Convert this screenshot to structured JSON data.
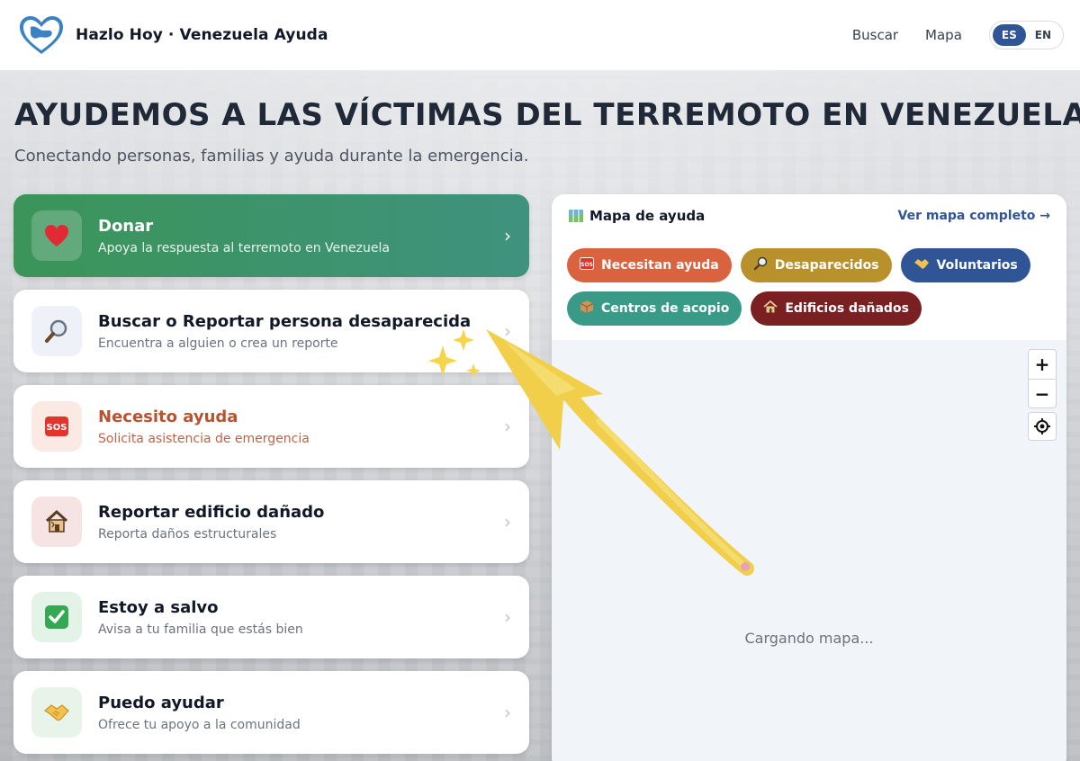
{
  "header": {
    "brand": "Hazlo Hoy · Venezuela Ayuda",
    "nav": {
      "search": "Buscar",
      "map": "Mapa"
    },
    "lang": {
      "es": "ES",
      "en": "EN",
      "active": "ES"
    }
  },
  "hero": {
    "title": "AYUDEMOS A LAS VÍCTIMAS DEL TERREMOTO EN VENEZUELA",
    "subtitle": "Conectando personas, familias y ayuda durante la emergencia."
  },
  "actions": [
    {
      "icon": "heart-icon",
      "title": "Donar",
      "description": "Apoya la respuesta al terremoto en Venezuela"
    },
    {
      "icon": "magnifier-icon",
      "title": "Buscar o Reportar persona desaparecida",
      "description": "Encuentra a alguien o crea un reporte"
    },
    {
      "icon": "sos-icon",
      "title": "Necesito ayuda",
      "description": "Solicita asistencia de emergencia"
    },
    {
      "icon": "damaged-house-icon",
      "title": "Reportar edificio dañado",
      "description": "Reporta daños estructurales"
    },
    {
      "icon": "check-icon",
      "title": "Estoy a salvo",
      "description": "Avisa a tu familia que estás bien"
    },
    {
      "icon": "handshake-icon",
      "title": "Puedo ayudar",
      "description": "Ofrece tu apoyo a la comunidad"
    }
  ],
  "map": {
    "title": "Mapa de ayuda",
    "full_map_link": "Ver mapa completo →",
    "filters": [
      {
        "label": "Necesitan ayuda",
        "icon": "sos-icon",
        "color": "#d9623f"
      },
      {
        "label": "Desaparecidos",
        "icon": "magnifier-icon",
        "color": "#b8912c"
      },
      {
        "label": "Voluntarios",
        "icon": "handshake-icon",
        "color": "#2f5597"
      },
      {
        "label": "Centros de acopio",
        "icon": "package-icon",
        "color": "#3a9a88"
      },
      {
        "label": "Edificios dañados",
        "icon": "damaged-house-icon",
        "color": "#7a1f22"
      }
    ],
    "loading": "Cargando mapa...",
    "zoom_in": "+",
    "zoom_out": "−"
  },
  "colors": {
    "accent": "#2f5597",
    "donate_green": "#3b9458",
    "annotation_yellow": "#f1cf4a"
  }
}
